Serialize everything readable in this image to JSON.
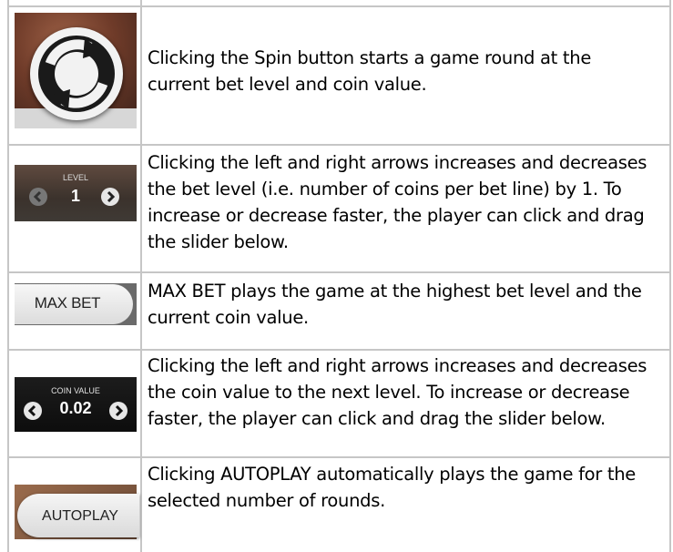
{
  "rows": [
    {
      "icon": "spin-icon",
      "description": "Clicking the Spin button starts a game round at the current bet level and coin value."
    },
    {
      "icon": "level-control",
      "thumb_label": "LEVEL",
      "thumb_value": "1",
      "description": "Clicking the left and right arrows increases and decreases the bet level (i.e. number of coins per bet line) by 1. To increase or decrease faster, the player can click and drag the slider below."
    },
    {
      "icon": "max-bet-button",
      "thumb_label": "MAX BET",
      "description": "MAX BET plays the game at the highest bet level and the current coin value."
    },
    {
      "icon": "coin-value-control",
      "thumb_label": "COIN VALUE",
      "thumb_value": "0.02",
      "description": "Clicking the left and right arrows increases and decreases the coin value to the next level. To increase or decrease faster, the player can click and drag the slider below."
    },
    {
      "icon": "autoplay-button",
      "thumb_label": "AUTOPLAY",
      "description": "Clicking AUTOPLAY automatically plays the game for the selected number of rounds."
    }
  ],
  "colors": {
    "grid_line": "#c6c6c6",
    "text": "#000000"
  }
}
